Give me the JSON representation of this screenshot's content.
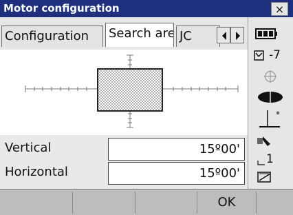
{
  "window": {
    "title": "Motor configuration",
    "close_label": "×"
  },
  "tabs": [
    {
      "label": "Configuration",
      "active": false
    },
    {
      "label": "Search area",
      "active": true
    },
    {
      "label": "JC",
      "active": false
    }
  ],
  "fields": {
    "vertical": {
      "label": "Vertical",
      "value": "15º00'"
    },
    "horizontal": {
      "label": "Horizontal",
      "value": "15º00'"
    }
  },
  "sidebar": {
    "tilt_value": "-7",
    "page_number": "1"
  },
  "softkeys": [
    "",
    "",
    "",
    "OK",
    ""
  ]
}
